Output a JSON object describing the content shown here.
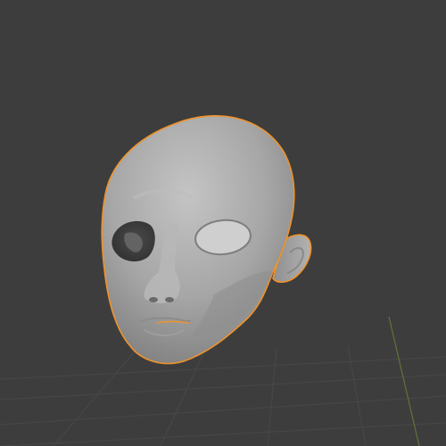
{
  "viewport": {
    "background_color": "#3d3d3d",
    "grid_color": "#4a4a4a",
    "axis_color_green": "#6f8a3a",
    "shading": "solid",
    "selection_outline_color": "#f0922a",
    "object": {
      "type": "sculpted-head-mesh",
      "selected": true,
      "surface_color": "#a9a9a9"
    }
  }
}
